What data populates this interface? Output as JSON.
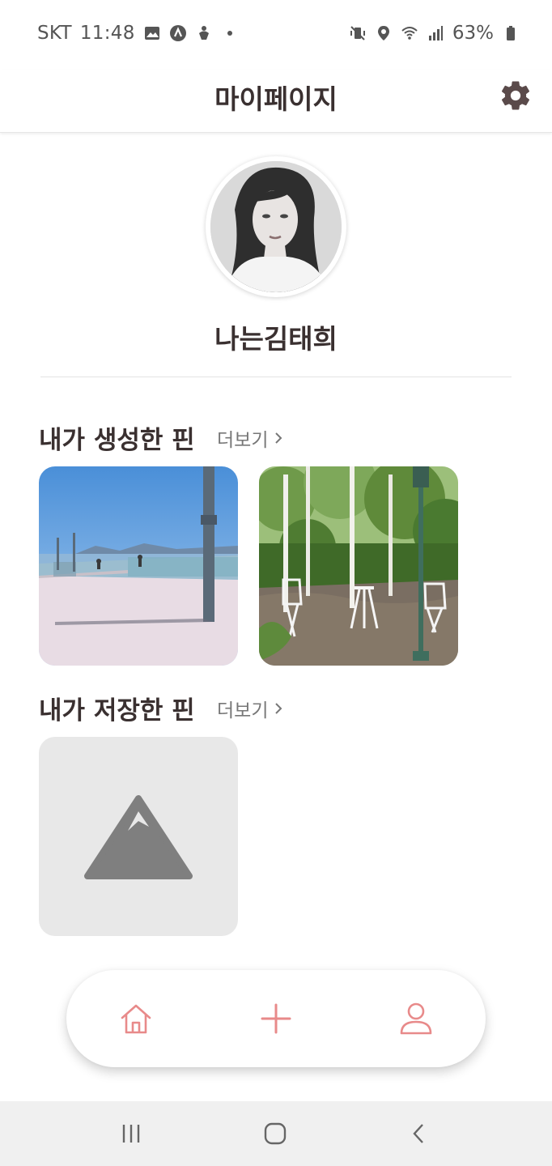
{
  "status_bar": {
    "carrier": "SKT",
    "time": "11:48",
    "battery": "63%",
    "left_icons": [
      "gallery-icon",
      "app-icon",
      "accessibility-icon",
      "dot-icon"
    ],
    "right_icons": [
      "mute-vibrate-icon",
      "location-icon",
      "wifi-icon",
      "signal-icon",
      "battery-icon"
    ]
  },
  "header": {
    "title": "마이페이지",
    "settings_icon": "gear-icon"
  },
  "profile": {
    "username": "나는김태희"
  },
  "created_pins": {
    "title": "내가 생성한 핀",
    "more_label": "더보기",
    "pins": [
      {
        "image": "seaside-promenade-photo"
      },
      {
        "image": "garden-cafe-photo"
      }
    ]
  },
  "saved_pins": {
    "title": "내가 저장한 핀",
    "more_label": "더보기",
    "pins": [
      {
        "image": "placeholder-mountain-icon"
      }
    ]
  },
  "bottom_nav": {
    "items": [
      {
        "icon": "home-icon"
      },
      {
        "icon": "plus-icon"
      },
      {
        "icon": "profile-icon"
      }
    ],
    "accent_color": "#e88a8a"
  },
  "system_nav": {
    "items": [
      "recent-apps-icon",
      "home-circle-icon",
      "back-icon"
    ]
  },
  "colors": {
    "title_text": "#3a3030",
    "accent": "#e88a8a",
    "placeholder_bg": "#e8e8e8",
    "placeholder_icon": "#7f7f7f"
  }
}
